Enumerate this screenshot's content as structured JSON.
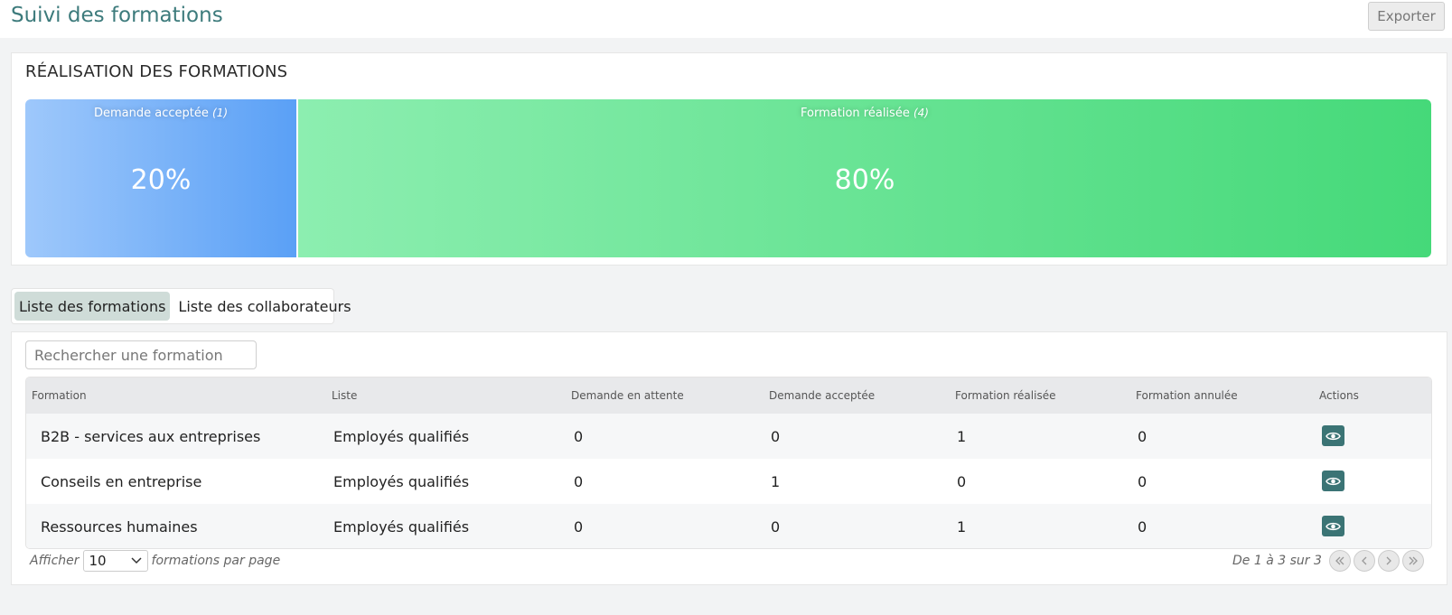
{
  "header": {
    "title": "Suivi des formations",
    "export_label": "Exporter"
  },
  "summary": {
    "title": "RÉALISATION DES FORMATIONS",
    "segments": [
      {
        "label": "Demande acceptée",
        "count": "(1)",
        "percent": "20%",
        "fraction": 0.2,
        "color": "#5aa0f6"
      },
      {
        "label": "Formation réalisée",
        "count": "(4)",
        "percent": "80%",
        "fraction": 0.8,
        "color": "#45d979"
      }
    ]
  },
  "tabs": [
    {
      "label": "Liste des formations",
      "active": true
    },
    {
      "label": "Liste des collaborateurs",
      "active": false
    }
  ],
  "search": {
    "placeholder": "Rechercher une formation",
    "value": ""
  },
  "table": {
    "headers": [
      "Formation",
      "Liste",
      "Demande en attente",
      "Demande acceptée",
      "Formation réalisée",
      "Formation annulée",
      "Actions"
    ],
    "rows": [
      [
        "B2B - services aux entreprises",
        "Employés qualifiés",
        "0",
        "0",
        "1",
        "0"
      ],
      [
        "Conseils en entreprise",
        "Employés qualifiés",
        "0",
        "1",
        "0",
        "0"
      ],
      [
        "Ressources humaines",
        "Employés qualifiés",
        "0",
        "0",
        "1",
        "0"
      ]
    ],
    "action_icon": "eye-icon"
  },
  "pagination": {
    "show_label": "Afficher",
    "page_size": "10",
    "per_page_label": "formations par page",
    "range_text": "De 1 à 3 sur 3"
  },
  "colors": {
    "accent": "#3d7b7c",
    "eye_button": "#3b7475",
    "active_tab": "#cfdcd8"
  }
}
